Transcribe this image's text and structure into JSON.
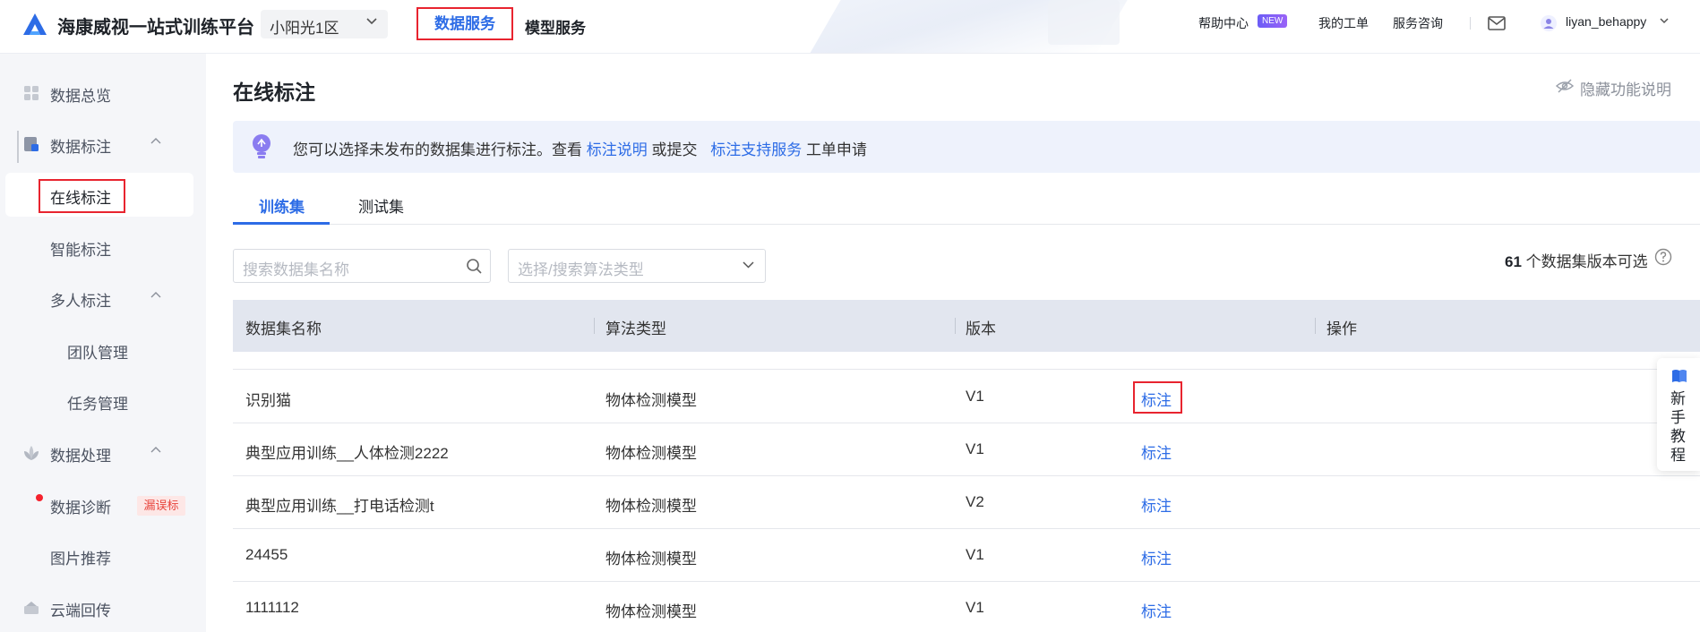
{
  "app": {
    "title": "海康威视一站式训练平台",
    "region": "小阳光1区"
  },
  "topnav": {
    "data_service": "数据服务",
    "model_service": "模型服务"
  },
  "header_right": {
    "help_center": "帮助中心",
    "new_badge": "NEW",
    "my_tickets": "我的工单",
    "consult": "服务咨询",
    "username": "liyan_behappy"
  },
  "sidebar": {
    "overview": "数据总览",
    "annotation": "数据标注",
    "online_annotation": "在线标注",
    "smart_annotation": "智能标注",
    "multi_annotation": "多人标注",
    "team_mgmt": "团队管理",
    "task_mgmt": "任务管理",
    "processing": "数据处理",
    "diagnosis": "数据诊断",
    "diagnosis_tag": "漏误标",
    "image_recommend": "图片推荐",
    "cloud_return": "云端回传"
  },
  "main": {
    "title": "在线标注",
    "hide_doc": "隐藏功能说明",
    "info": {
      "prefix": "您可以选择未发布的数据集进行标注。查看",
      "link1": "标注说明",
      "middle": "或提交",
      "link2": "标注支持服务",
      "suffix": "工单申请"
    },
    "tabs": [
      "训练集",
      "测试集"
    ],
    "search_placeholder": "搜索数据集名称",
    "select_placeholder": "选择/搜索算法类型",
    "count_number": "61",
    "count_text": "个数据集版本可选",
    "columns": [
      "数据集名称",
      "算法类型",
      "版本",
      "操作"
    ],
    "rows": [
      {
        "name": "识别猫",
        "algo": "物体检测模型",
        "version": "V1",
        "op": "标注"
      },
      {
        "name": "典型应用训练__人体检测2222",
        "algo": "物体检测模型",
        "version": "V1",
        "op": "标注"
      },
      {
        "name": "典型应用训练__打电话检测t",
        "algo": "物体检测模型",
        "version": "V2",
        "op": "标注"
      },
      {
        "name": "24455",
        "algo": "物体检测模型",
        "version": "V1",
        "op": "标注"
      },
      {
        "name": "1111112",
        "algo": "物体检测模型",
        "version": "V1",
        "op": "标注"
      }
    ]
  },
  "tutorial": "新手教程",
  "colors": {
    "accent": "#2d6ce6",
    "highlight_red": "#e8242f"
  }
}
